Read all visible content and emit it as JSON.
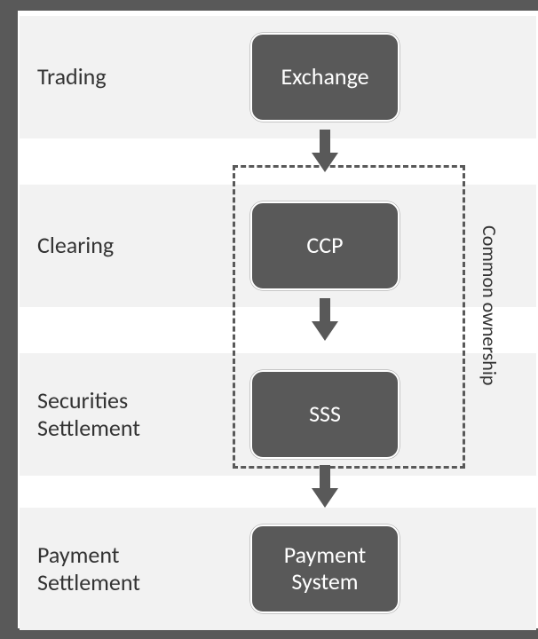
{
  "stages": [
    {
      "label": "Trading",
      "box": "Exchange"
    },
    {
      "label": "Clearing",
      "box": "CCP"
    },
    {
      "label": "Securities Settlement",
      "box": "SSS"
    },
    {
      "label": "Payment Settlement",
      "box": "Payment System"
    }
  ],
  "group_label": "Common ownership"
}
